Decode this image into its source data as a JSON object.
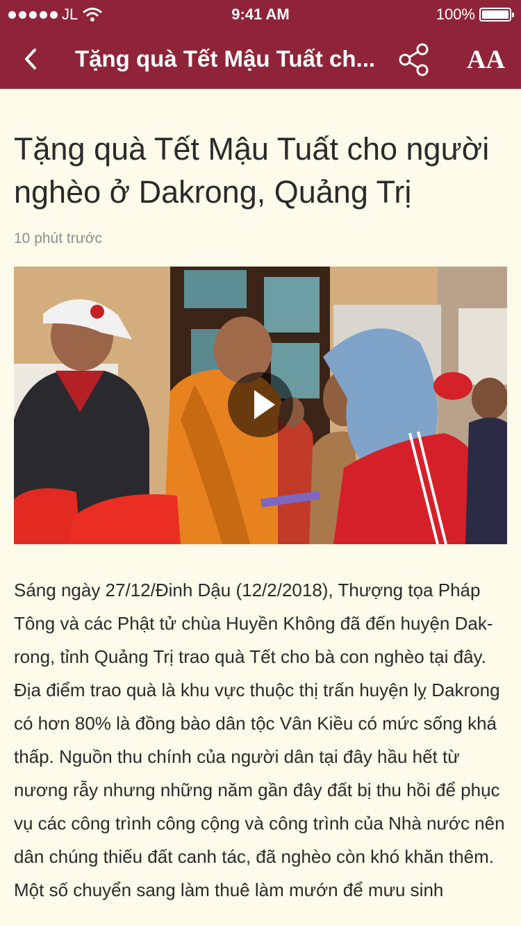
{
  "status_bar": {
    "carrier": "JL",
    "time": "9:41 AM",
    "battery": "100%",
    "battery_level": 1.0
  },
  "nav": {
    "title": "Tặng quà Tết Mậu Tuất ch...",
    "back_icon": "chevron-left-icon",
    "share_icon": "share-icon",
    "font_size_icon": "font-size-icon",
    "font_size_glyph": "AA",
    "bar_color": "#8f2438"
  },
  "article": {
    "headline": "Tặng quà Tết Mậu Tuất cho người nghèo ở Dakrong, Quảng Trị",
    "timestamp": "10 phút trước",
    "video": {
      "play_icon": "play-icon"
    },
    "body": "Sáng ngày 27/12/Đinh Dậu (12/2/2018), Thượng tọa Pháp Tông và các Phật tử chùa Huyền Không đã đến huyện Dak- rong, tỉnh Quảng Trị trao quà Tết cho bà con nghèo tại đây. Địa điểm trao quà là khu vực thuộc thị trấn huyện lỵ Dakrong có hơn 80% là đồng bào dân tộc Vân Kiều có mức sống khá thấp. Nguồn thu chính của người dân tại đây hầu hết từ nương rẫy nhưng những năm gần đây đất bị thu hồi để phục vụ các công trình công cộng và công trình của Nhà nước nên dân chúng thiếu đất canh tác, đã nghèo còn khó khăn thêm. Một số chuyển sang làm thuê làm mướn để mưu sinh"
  },
  "colors": {
    "background": "#fdfbea",
    "accent": "#8f2438",
    "text": "#2a2a2a",
    "muted": "#8e8e8e"
  }
}
